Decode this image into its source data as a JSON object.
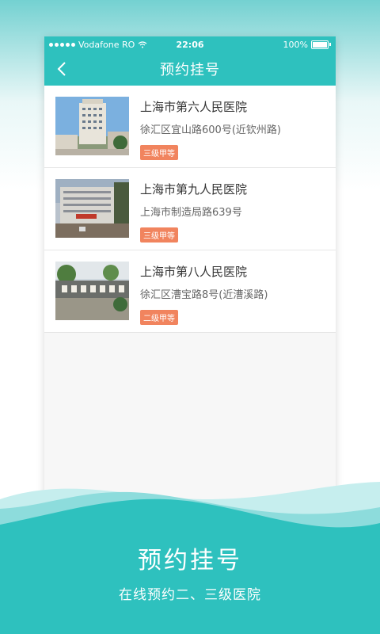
{
  "statusbar": {
    "carrier": "Vodafone RO",
    "time": "22:06",
    "battery": "100%"
  },
  "navbar": {
    "title": "预约挂号",
    "back_icon": "chevron-left-icon"
  },
  "hospitals": [
    {
      "name": "上海市第六人民医院",
      "address": "徐汇区宜山路600号(近钦州路)",
      "level": "三级甲等"
    },
    {
      "name": "上海市第九人民医院",
      "address": "上海市制造局路639号",
      "level": "三级甲等"
    },
    {
      "name": "上海市第八人民医院",
      "address": "徐汇区漕宝路8号(近漕溪路)",
      "level": "二级甲等"
    }
  ],
  "promo": {
    "title": "预约挂号",
    "subtitle": "在线预约二、三级医院"
  },
  "colors": {
    "primary": "#2ec1be",
    "badge": "#f1845e"
  }
}
